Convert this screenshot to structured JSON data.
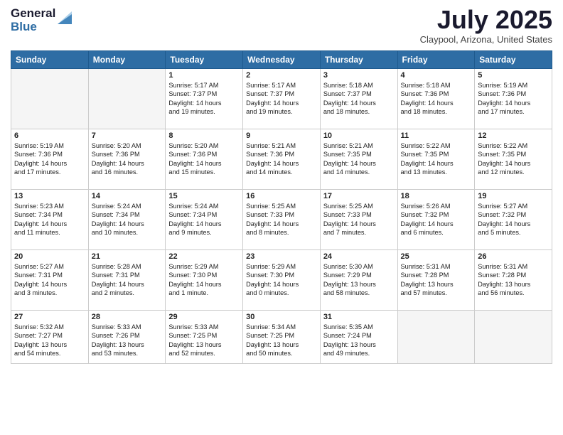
{
  "logo": {
    "general": "General",
    "blue": "Blue"
  },
  "title": "July 2025",
  "location": "Claypool, Arizona, United States",
  "headers": [
    "Sunday",
    "Monday",
    "Tuesday",
    "Wednesday",
    "Thursday",
    "Friday",
    "Saturday"
  ],
  "weeks": [
    [
      {
        "day": "",
        "content": ""
      },
      {
        "day": "",
        "content": ""
      },
      {
        "day": "1",
        "content": "Sunrise: 5:17 AM\nSunset: 7:37 PM\nDaylight: 14 hours\nand 19 minutes."
      },
      {
        "day": "2",
        "content": "Sunrise: 5:17 AM\nSunset: 7:37 PM\nDaylight: 14 hours\nand 19 minutes."
      },
      {
        "day": "3",
        "content": "Sunrise: 5:18 AM\nSunset: 7:37 PM\nDaylight: 14 hours\nand 18 minutes."
      },
      {
        "day": "4",
        "content": "Sunrise: 5:18 AM\nSunset: 7:36 PM\nDaylight: 14 hours\nand 18 minutes."
      },
      {
        "day": "5",
        "content": "Sunrise: 5:19 AM\nSunset: 7:36 PM\nDaylight: 14 hours\nand 17 minutes."
      }
    ],
    [
      {
        "day": "6",
        "content": "Sunrise: 5:19 AM\nSunset: 7:36 PM\nDaylight: 14 hours\nand 17 minutes."
      },
      {
        "day": "7",
        "content": "Sunrise: 5:20 AM\nSunset: 7:36 PM\nDaylight: 14 hours\nand 16 minutes."
      },
      {
        "day": "8",
        "content": "Sunrise: 5:20 AM\nSunset: 7:36 PM\nDaylight: 14 hours\nand 15 minutes."
      },
      {
        "day": "9",
        "content": "Sunrise: 5:21 AM\nSunset: 7:36 PM\nDaylight: 14 hours\nand 14 minutes."
      },
      {
        "day": "10",
        "content": "Sunrise: 5:21 AM\nSunset: 7:35 PM\nDaylight: 14 hours\nand 14 minutes."
      },
      {
        "day": "11",
        "content": "Sunrise: 5:22 AM\nSunset: 7:35 PM\nDaylight: 14 hours\nand 13 minutes."
      },
      {
        "day": "12",
        "content": "Sunrise: 5:22 AM\nSunset: 7:35 PM\nDaylight: 14 hours\nand 12 minutes."
      }
    ],
    [
      {
        "day": "13",
        "content": "Sunrise: 5:23 AM\nSunset: 7:34 PM\nDaylight: 14 hours\nand 11 minutes."
      },
      {
        "day": "14",
        "content": "Sunrise: 5:24 AM\nSunset: 7:34 PM\nDaylight: 14 hours\nand 10 minutes."
      },
      {
        "day": "15",
        "content": "Sunrise: 5:24 AM\nSunset: 7:34 PM\nDaylight: 14 hours\nand 9 minutes."
      },
      {
        "day": "16",
        "content": "Sunrise: 5:25 AM\nSunset: 7:33 PM\nDaylight: 14 hours\nand 8 minutes."
      },
      {
        "day": "17",
        "content": "Sunrise: 5:25 AM\nSunset: 7:33 PM\nDaylight: 14 hours\nand 7 minutes."
      },
      {
        "day": "18",
        "content": "Sunrise: 5:26 AM\nSunset: 7:32 PM\nDaylight: 14 hours\nand 6 minutes."
      },
      {
        "day": "19",
        "content": "Sunrise: 5:27 AM\nSunset: 7:32 PM\nDaylight: 14 hours\nand 5 minutes."
      }
    ],
    [
      {
        "day": "20",
        "content": "Sunrise: 5:27 AM\nSunset: 7:31 PM\nDaylight: 14 hours\nand 3 minutes."
      },
      {
        "day": "21",
        "content": "Sunrise: 5:28 AM\nSunset: 7:31 PM\nDaylight: 14 hours\nand 2 minutes."
      },
      {
        "day": "22",
        "content": "Sunrise: 5:29 AM\nSunset: 7:30 PM\nDaylight: 14 hours\nand 1 minute."
      },
      {
        "day": "23",
        "content": "Sunrise: 5:29 AM\nSunset: 7:30 PM\nDaylight: 14 hours\nand 0 minutes."
      },
      {
        "day": "24",
        "content": "Sunrise: 5:30 AM\nSunset: 7:29 PM\nDaylight: 13 hours\nand 58 minutes."
      },
      {
        "day": "25",
        "content": "Sunrise: 5:31 AM\nSunset: 7:28 PM\nDaylight: 13 hours\nand 57 minutes."
      },
      {
        "day": "26",
        "content": "Sunrise: 5:31 AM\nSunset: 7:28 PM\nDaylight: 13 hours\nand 56 minutes."
      }
    ],
    [
      {
        "day": "27",
        "content": "Sunrise: 5:32 AM\nSunset: 7:27 PM\nDaylight: 13 hours\nand 54 minutes."
      },
      {
        "day": "28",
        "content": "Sunrise: 5:33 AM\nSunset: 7:26 PM\nDaylight: 13 hours\nand 53 minutes."
      },
      {
        "day": "29",
        "content": "Sunrise: 5:33 AM\nSunset: 7:25 PM\nDaylight: 13 hours\nand 52 minutes."
      },
      {
        "day": "30",
        "content": "Sunrise: 5:34 AM\nSunset: 7:25 PM\nDaylight: 13 hours\nand 50 minutes."
      },
      {
        "day": "31",
        "content": "Sunrise: 5:35 AM\nSunset: 7:24 PM\nDaylight: 13 hours\nand 49 minutes."
      },
      {
        "day": "",
        "content": ""
      },
      {
        "day": "",
        "content": ""
      }
    ]
  ]
}
